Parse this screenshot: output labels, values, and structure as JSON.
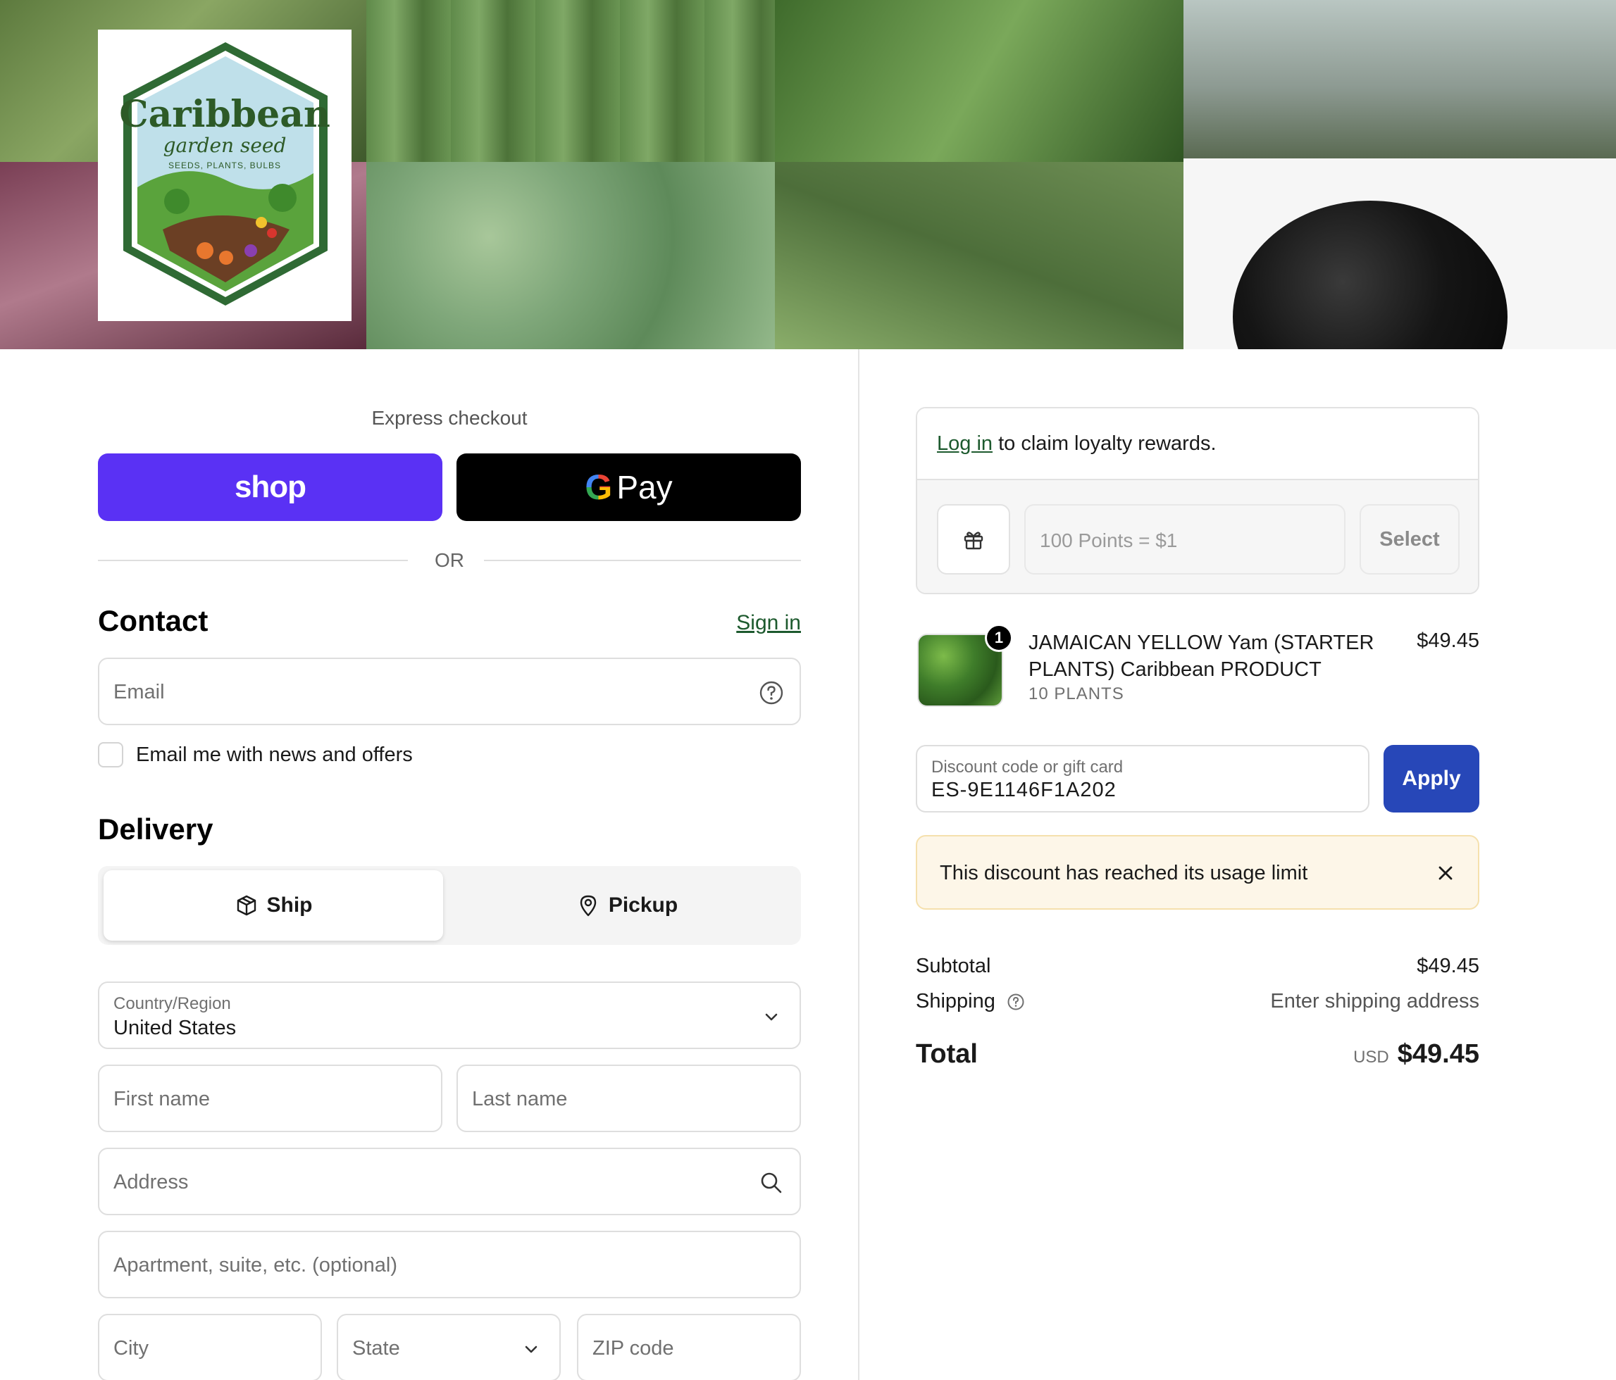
{
  "brand": {
    "logo_title": "Caribbean",
    "logo_subtitle": "garden seed",
    "logo_tagline": "SEEDS, PLANTS, BULBS"
  },
  "express": {
    "title": "Express checkout",
    "shop_label": "shop",
    "gpay_g": "G",
    "gpay_label": "Pay",
    "or_label": "OR"
  },
  "contact": {
    "title": "Contact",
    "signin_label": "Sign in",
    "email_placeholder": "Email",
    "newsletter_label": "Email me with news and offers"
  },
  "delivery": {
    "title": "Delivery",
    "options": [
      {
        "label": "Ship",
        "icon": "box-icon",
        "selected": true
      },
      {
        "label": "Pickup",
        "icon": "location-pin-icon",
        "selected": false
      }
    ],
    "country_label": "Country/Region",
    "country_value": "United States",
    "first_name_placeholder": "First name",
    "last_name_placeholder": "Last name",
    "address_placeholder": "Address",
    "apartment_placeholder": "Apartment, suite, etc. (optional)",
    "city_placeholder": "City",
    "state_placeholder": "State",
    "zip_placeholder": "ZIP code"
  },
  "loyalty": {
    "login_link": "Log in",
    "message": " to claim loyalty rewards.",
    "points_placeholder": "100 Points = $1",
    "select_label": "Select"
  },
  "cart": {
    "items": [
      {
        "name": "JAMAICAN YELLOW Yam (STARTER PLANTS) Caribbean PRODUCT",
        "variant": "10 PLANTS",
        "price": "$49.45",
        "quantity": "1"
      }
    ]
  },
  "discount": {
    "label": "Discount code or gift card",
    "value": "ES-9E1146F1A202",
    "apply_label": "Apply",
    "error": "This discount has reached its usage limit"
  },
  "summary": {
    "subtotal_label": "Subtotal",
    "subtotal_value": "$49.45",
    "shipping_label": "Shipping",
    "shipping_value": "Enter shipping address",
    "total_label": "Total",
    "currency": "USD",
    "total_value": "$49.45"
  },
  "colors": {
    "shop_pay": "#5a31f4",
    "apply_button": "#2747b8",
    "link_green": "#1d5a2e",
    "alert_bg": "#fdf6e8"
  }
}
